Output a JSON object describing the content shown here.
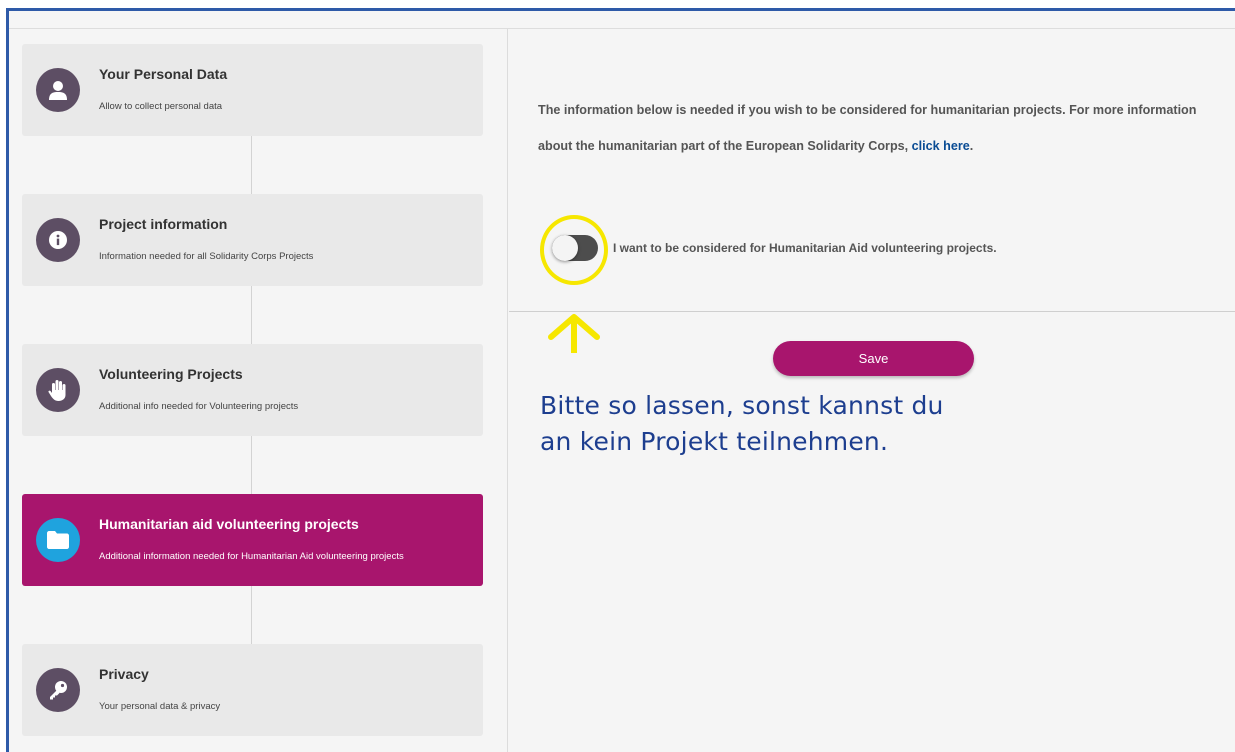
{
  "steps": [
    {
      "title": "Your Personal Data",
      "subtitle": "Allow to collect personal data",
      "icon": "user-icon",
      "active": false
    },
    {
      "title": "Project information",
      "subtitle": "Information needed for all Solidarity Corps Projects",
      "icon": "info-icon",
      "active": false
    },
    {
      "title": "Volunteering Projects",
      "subtitle": "Additional info needed for Volunteering projects",
      "icon": "hand-icon",
      "active": false
    },
    {
      "title": "Humanitarian aid volunteering projects",
      "subtitle": "Additional information needed for Humanitarian Aid volunteering projects",
      "icon": "folder-icon",
      "active": true
    },
    {
      "title": "Privacy",
      "subtitle": "Your personal data & privacy",
      "icon": "key-icon",
      "active": false
    }
  ],
  "main": {
    "info_text": "The information below is needed if you wish to be considered for humanitarian projects. For more information about the humanitarian part of the European Solidarity Corps,",
    "info_link": "click here",
    "info_end": ".",
    "toggle_label": "I want to be considered for Humanitarian Aid volunteering projects.",
    "toggle_on": false,
    "save_label": "Save"
  },
  "annotation": {
    "line1": "Bitte so lassen, sonst kannst du",
    "line2": "an kein Projekt teilnehmen."
  },
  "colors": {
    "accent": "#a8156d",
    "active_icon": "#1fa3de",
    "icon_circle": "#5d4e64",
    "link": "#0a4c94",
    "annotation": "#1d3e8f",
    "highlight": "#f6e700"
  }
}
